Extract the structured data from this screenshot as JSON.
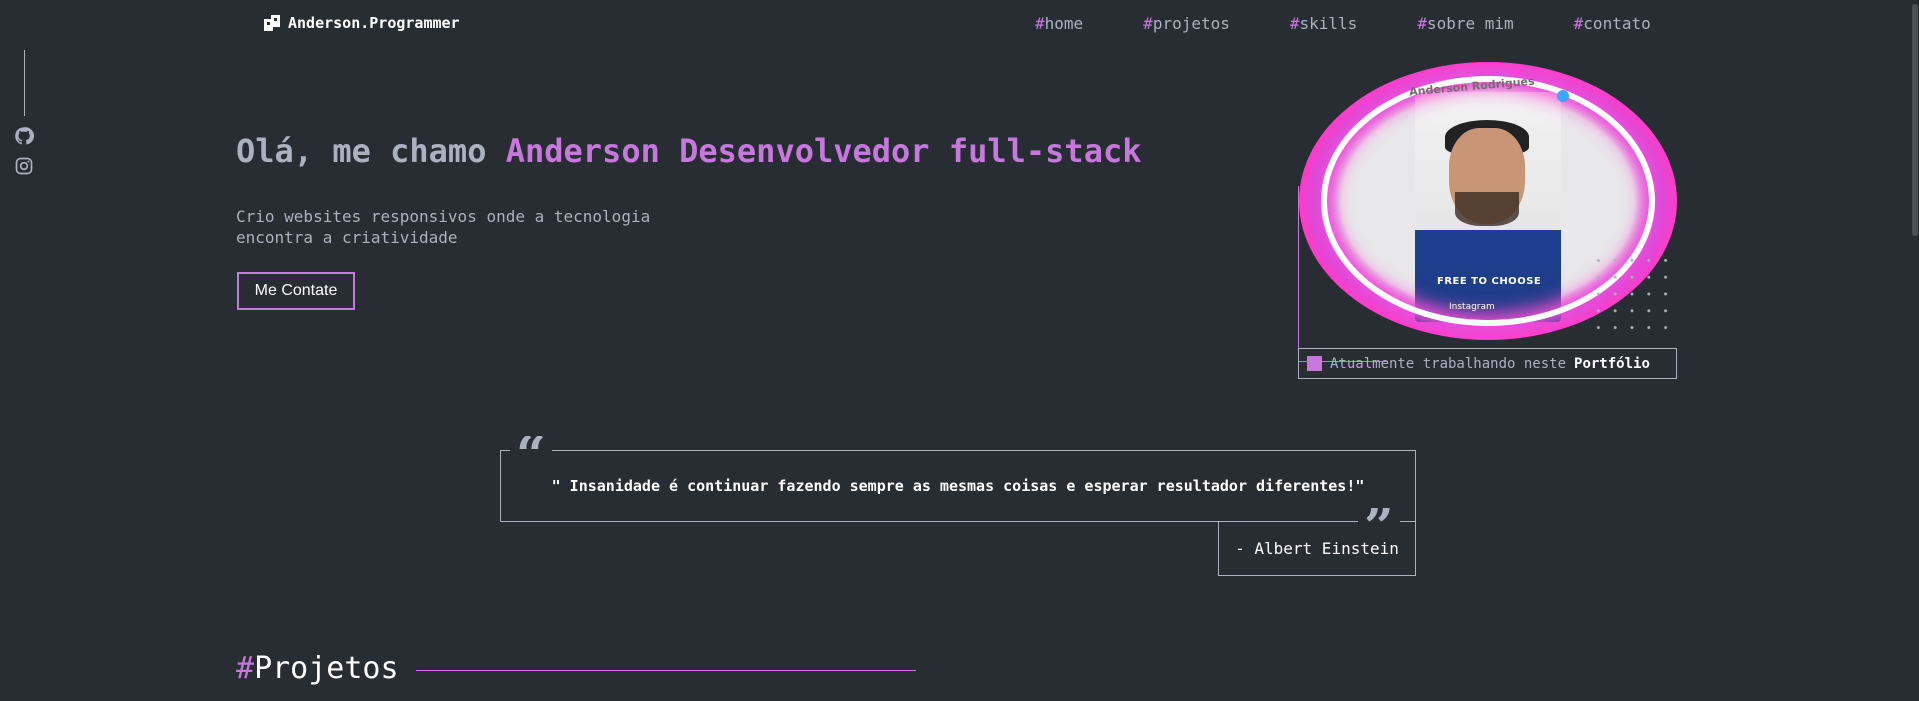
{
  "header": {
    "logo_text": "Anderson.Programmer",
    "nav": [
      {
        "hash": "#",
        "label": "home"
      },
      {
        "hash": "#",
        "label": "projetos"
      },
      {
        "hash": "#",
        "label": "skills"
      },
      {
        "hash": "#",
        "label": "sobre mim"
      },
      {
        "hash": "#",
        "label": "contato"
      }
    ]
  },
  "social": {
    "icons": [
      "github-icon",
      "instagram-icon"
    ]
  },
  "hero": {
    "title_prefix": "Olá, me chamo ",
    "title_highlight": "Anderson Desenvolvedor full-stack",
    "subtitle": "Crio websites responsivos onde a tecnologia encontra a criatividade",
    "button_label": "Me Contate"
  },
  "portrait": {
    "caption": "Anderson Rodrigues",
    "shirt_text": "FREE TO CHOOSE",
    "bottom_text": "Instagram"
  },
  "status": {
    "prefix": "Atualmente trabalhando neste ",
    "project": "Portfólio"
  },
  "quote": {
    "text": "\" Insanidade é continuar fazendo sempre as mesmas coisas e esperar resultador diferentes!\"",
    "author": "- Albert Einstein",
    "open_mark": "“",
    "close_mark": "”"
  },
  "section": {
    "hash": "#",
    "title": "Projetos"
  },
  "colors": {
    "background": "#282c33",
    "accent": "#c778dd",
    "text": "#abb2bf",
    "white": "#ffffff"
  }
}
